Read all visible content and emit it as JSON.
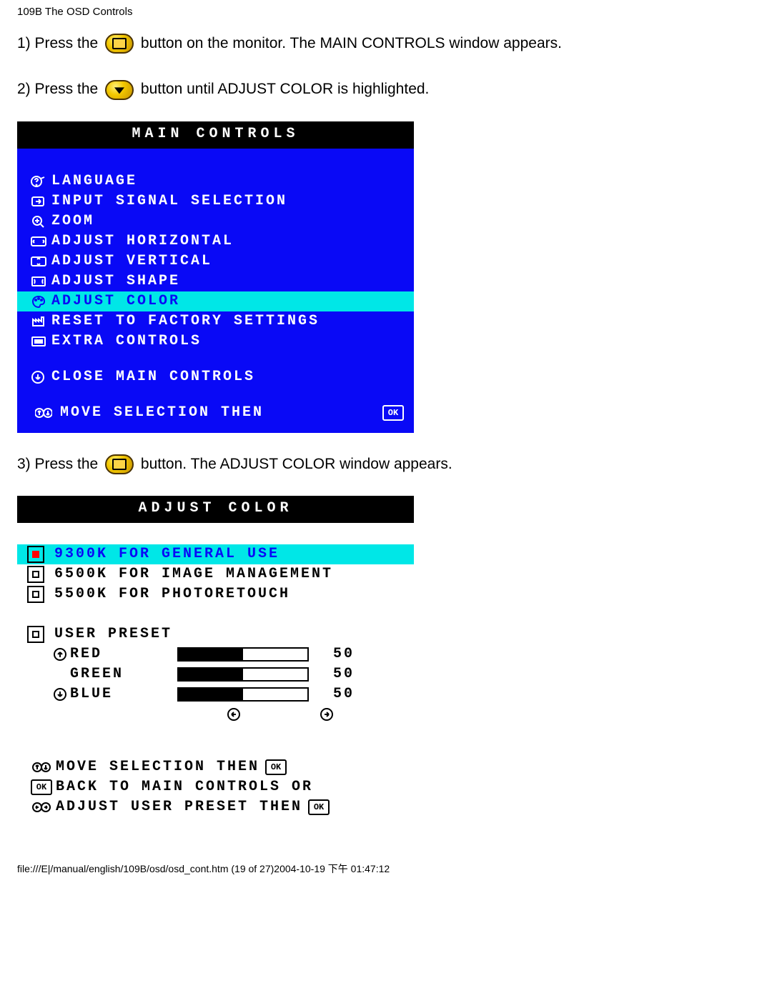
{
  "page_header": "109B The OSD Controls",
  "step1_a": "1) Press the ",
  "step1_b": " button on the monitor. The MAIN CONTROLS window appears.",
  "step2_a": "2) Press the ",
  "step2_b": "button until ADJUST COLOR is highlighted.",
  "step3_a": "3) Press the ",
  "step3_b": " button. The ADJUST COLOR window appears.",
  "main_controls": {
    "title": "MAIN CONTROLS",
    "items": [
      {
        "icon": "question",
        "label": "LANGUAGE"
      },
      {
        "icon": "arrow-box",
        "label": "INPUT SIGNAL SELECTION"
      },
      {
        "icon": "zoom",
        "label": "ZOOM"
      },
      {
        "icon": "arrows-h",
        "label": "ADJUST HORIZONTAL"
      },
      {
        "icon": "arrows-v",
        "label": "ADJUST VERTICAL"
      },
      {
        "icon": "shape",
        "label": "ADJUST SHAPE"
      },
      {
        "icon": "palette",
        "label": "ADJUST COLOR",
        "highlight": true
      },
      {
        "icon": "factory",
        "label": "RESET TO FACTORY SETTINGS"
      },
      {
        "icon": "list",
        "label": "EXTRA CONTROLS"
      }
    ],
    "close_label": "CLOSE MAIN CONTROLS",
    "footer": "MOVE SELECTION THEN"
  },
  "adjust_color": {
    "title": "ADJUST COLOR",
    "options": [
      {
        "label": "9300K FOR GENERAL USE",
        "selected": true,
        "highlight": true
      },
      {
        "label": "6500K FOR IMAGE MANAGEMENT",
        "selected": false
      },
      {
        "label": "5500K FOR PHOTORETOUCH",
        "selected": false
      }
    ],
    "user_preset_label": "USER PRESET",
    "rgb": [
      {
        "name": "RED",
        "value": 50
      },
      {
        "name": "GREEN",
        "value": 50
      },
      {
        "name": "BLUE",
        "value": 50
      }
    ],
    "footer1": "MOVE SELECTION THEN",
    "footer2": "BACK TO MAIN CONTROLS OR",
    "footer3": "ADJUST USER PRESET THEN"
  },
  "page_footer": "file:///E|/manual/english/109B/osd/osd_cont.htm (19 of 27)2004-10-19 下午 01:47:12"
}
